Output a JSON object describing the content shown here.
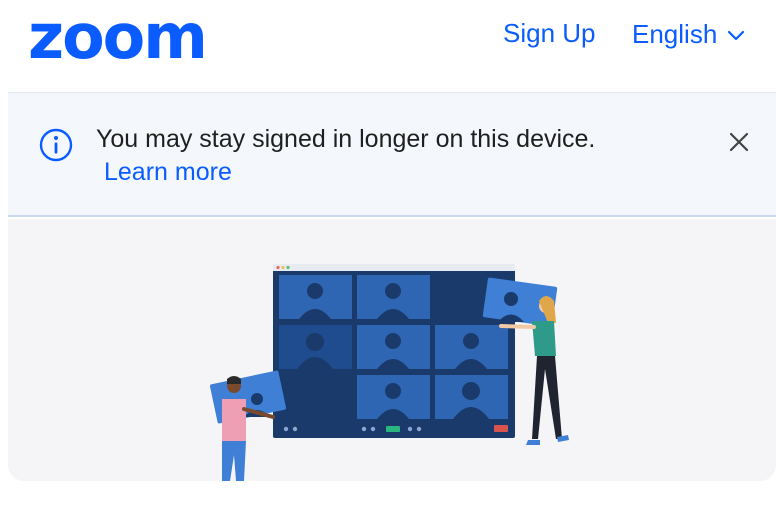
{
  "header": {
    "logo_text": "zoom",
    "signup_label": "Sign Up",
    "language_label": "English"
  },
  "banner": {
    "message": "You may stay signed in longer on this device.",
    "link_label": "Learn more"
  },
  "icons": {
    "language": "chevron-down-icon",
    "banner": "info-icon",
    "dismiss": "close-icon"
  },
  "colors": {
    "brand": "#0B5CFF",
    "banner_background": "#F4F8FD",
    "hero_background": "#F5F5F7",
    "screen": "#1A3A6B",
    "tile": "#2F66B4"
  }
}
